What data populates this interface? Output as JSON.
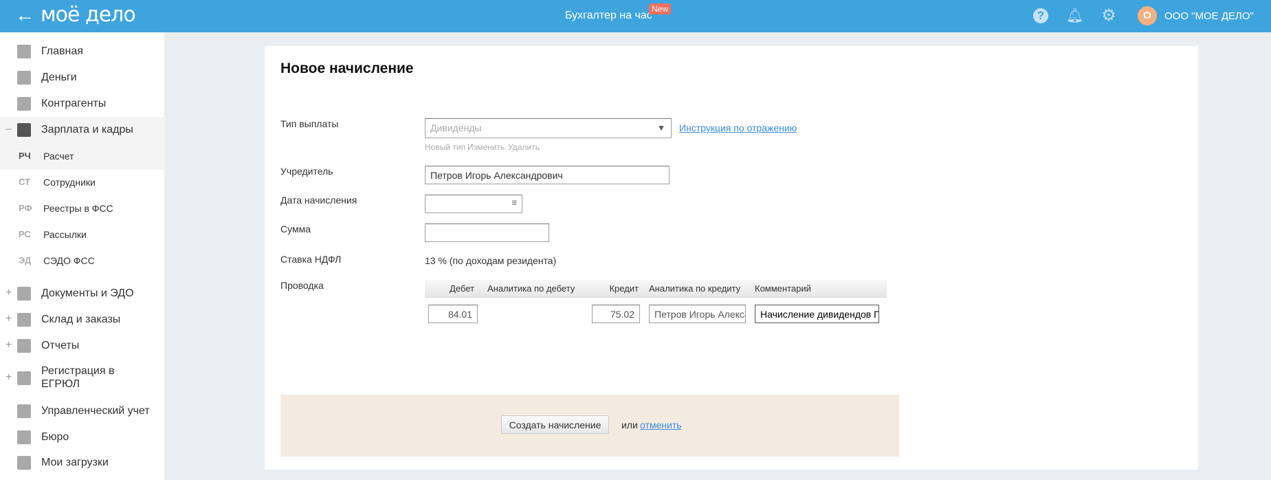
{
  "header": {
    "back_icon": "arrow-left-icon",
    "logo": "моё дело",
    "service": "Бухгалтер на час",
    "new_badge": "New",
    "avatar_letter": "О",
    "company": "ООО \"МОЕ ДЕЛО\"",
    "accent": "#3ea4de"
  },
  "sidebar": {
    "items": [
      {
        "label": "Главная",
        "icon": "home-icon"
      },
      {
        "label": "Деньги",
        "icon": "money-icon"
      },
      {
        "label": "Контрагенты",
        "icon": "contractor-icon"
      },
      {
        "label": "Зарплата и кадры",
        "icon": "wallet-icon",
        "toggle": "–"
      },
      {
        "label": "Документы и ЭДО",
        "icon": "folder-icon",
        "toggle": "+"
      },
      {
        "label": "Склад и заказы",
        "icon": "warehouse-icon",
        "toggle": "+"
      },
      {
        "label": "Отчеты",
        "icon": "report-icon",
        "toggle": "+"
      },
      {
        "label": "Регистрация в ЕГРЮЛ",
        "icon": "registration-icon",
        "toggle": "+"
      },
      {
        "label": "Управленческий учет",
        "icon": "ruble-icon"
      },
      {
        "label": "Бюро",
        "icon": "briefcase-icon"
      },
      {
        "label": "Мои загрузки",
        "icon": "folder-icon"
      }
    ],
    "subitems": [
      {
        "abbr": "РЧ",
        "label": "Расчет"
      },
      {
        "abbr": "СТ",
        "label": "Сотрудники"
      },
      {
        "abbr": "РФ",
        "label": "Реестры в ФСС"
      },
      {
        "abbr": "РС",
        "label": "Рассылки"
      },
      {
        "abbr": "ЭД",
        "label": "СЭДО ФСС"
      }
    ]
  },
  "form": {
    "title": "Новое начисление",
    "payment_type_label": "Тип выплаты",
    "payment_type_value": "Дивиденды",
    "instruction_link": "Инструкция по отражению",
    "type_actions": [
      "Новый тип",
      "Изменить",
      "Удалить"
    ],
    "founder_label": "Учредитель",
    "founder_value": "Петров Игорь Александрович",
    "date_label": "Дата начисления",
    "date_value": "",
    "sum_label": "Сумма",
    "sum_value": "",
    "ndfl_label": "Ставка НДФЛ",
    "ndfl_value": "13 % (по доходам резидента)",
    "posting_label": "Проводка",
    "columns": [
      "Дебет",
      "Аналитика по дебету",
      "Кредит",
      "Аналитика по кредиту",
      "Комментарий"
    ],
    "row": {
      "debit": "84.01",
      "debit_analytics": "",
      "credit": "75.02",
      "credit_analytics": "Петров Игорь Александрович",
      "comment": "Начисление дивидендов Петров Игорь Александрович"
    },
    "create_button": "Создать начисление",
    "or": "или",
    "cancel_link": "отменить"
  }
}
